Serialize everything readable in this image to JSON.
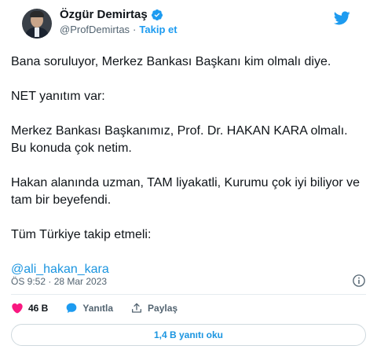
{
  "author": {
    "name": "Özgür Demirtaş",
    "handle": "@ProfDemirtas",
    "separator": "·",
    "follow_label": "Takip et"
  },
  "tweet": {
    "paragraphs": [
      "Bana soruluyor, Merkez Bankası Başkanı kim olmalı diye.",
      "NET yanıtım var:",
      "Merkez Bankası Başkanımız, Prof. Dr. HAKAN KARA olmalı. Bu konuda çok netim.",
      "Hakan alanında uzman, TAM liyakatli, Kurumu çok iyi biliyor ve tam bir beyefendi.",
      "Tüm Türkiye takip etmeli:"
    ],
    "mention": "@ali_hakan_kara",
    "timestamp": "ÖS 9:52 · 28 Mar 2023"
  },
  "actions": {
    "likes": "46 B",
    "reply_label": "Yanıtla",
    "share_label": "Paylaş"
  },
  "read_replies_label": "1,4 B yanıtı oku",
  "colors": {
    "accent": "#1d9bf0",
    "like": "#f91880",
    "text": "#0f1419",
    "muted": "#536471"
  },
  "icons": [
    "verified-badge-icon",
    "twitter-bird-icon",
    "info-icon",
    "heart-icon",
    "reply-bubble-icon",
    "share-icon"
  ]
}
